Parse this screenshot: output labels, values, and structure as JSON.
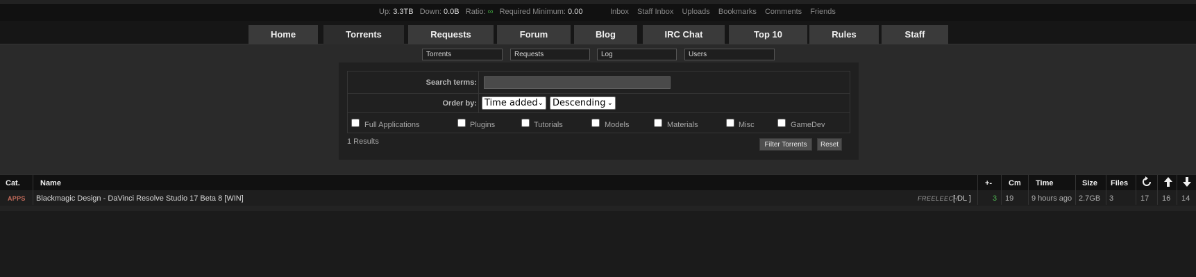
{
  "stats": {
    "up_label": "Up:",
    "up_value": "3.3TB",
    "down_label": "Down:",
    "down_value": "0.0B",
    "ratio_label": "Ratio:",
    "ratio_value": "∞",
    "required_label": "Required Minimum:",
    "required_value": "0.00"
  },
  "user_links": [
    "Inbox",
    "Staff Inbox",
    "Uploads",
    "Bookmarks",
    "Comments",
    "Friends"
  ],
  "nav": {
    "tabs": [
      "Home",
      "Torrents",
      "Requests",
      "Forum",
      "Blog",
      "IRC Chat",
      "Top 10",
      "Rules",
      "Staff"
    ],
    "active": "Torrents"
  },
  "quick_search": [
    "Torrents",
    "Requests",
    "Log",
    "Users"
  ],
  "search": {
    "terms_label": "Search terms:",
    "terms_value": "",
    "order_label": "Order by:",
    "order_by": "Time added",
    "order_dir": "Descending",
    "categories": [
      "Full Applications",
      "Plugins",
      "Tutorials",
      "Models",
      "Materials",
      "Misc",
      "GameDev"
    ],
    "results_text": "1 Results",
    "filter_button": "Filter Torrents",
    "reset_button": "Reset"
  },
  "table": {
    "headers": {
      "cat": "Cat.",
      "name": "Name",
      "pm": "+-",
      "cm": "Cm",
      "time": "Time",
      "size": "Size",
      "files": "Files"
    },
    "header_icons": [
      "refresh-icon",
      "arrow-up-icon",
      "arrow-down-icon"
    ],
    "rows": [
      {
        "cat": "APPS",
        "name": "Blackmagic Design - DaVinci Resolve Studio 17 Beta 8 [WIN]",
        "freeleech": "FREELEECH",
        "dl": "[ DL ]",
        "pm": "3",
        "cm": "19",
        "time": "9 hours ago",
        "size": "2.7GB",
        "files": "3",
        "snatched": "17",
        "seeders": "16",
        "leechers": "14"
      }
    ]
  },
  "colors": {
    "background": "#1b1b1b",
    "nav_tab": "#3a3a3a",
    "category": "#c26a5a",
    "positive": "#4caf50"
  }
}
